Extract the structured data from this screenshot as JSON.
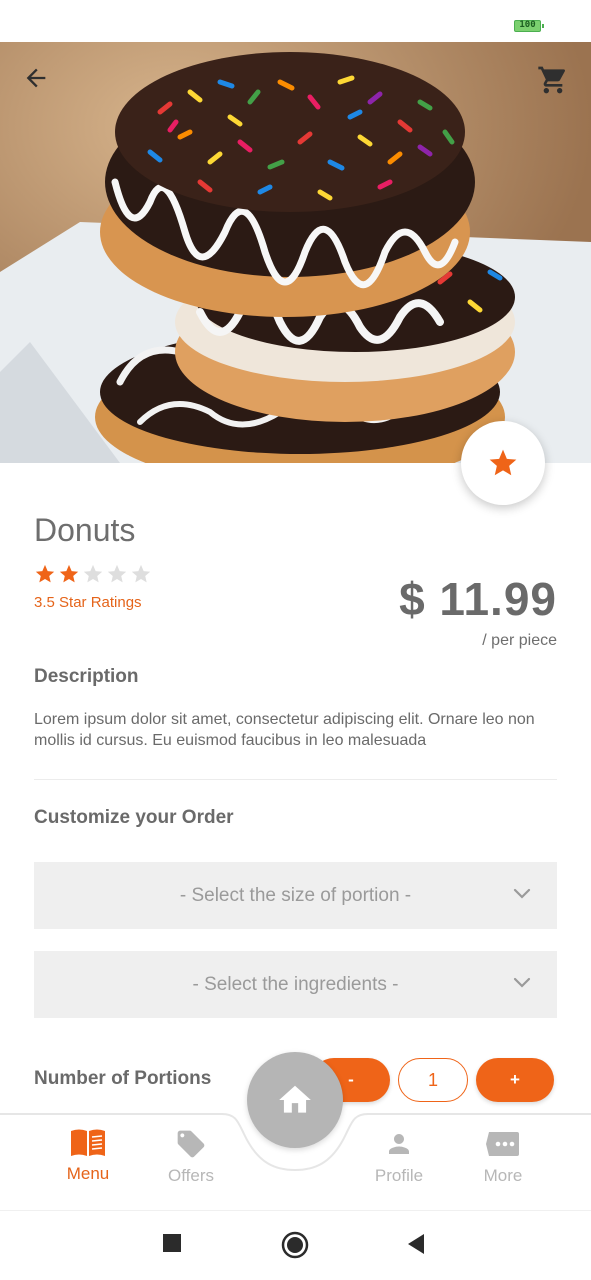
{
  "status_bar": {
    "battery": "100"
  },
  "product": {
    "name": "Donuts",
    "rating": 2,
    "rating_max": 5,
    "rating_text": "3.5 Star Ratings",
    "price": "$ 11.99",
    "price_unit": "/ per piece"
  },
  "description": {
    "title": "Description",
    "text": "Lorem ipsum dolor sit amet, consectetur adipiscing elit. Ornare leo non mollis id cursus. Eu euismod faucibus in leo malesuada"
  },
  "customize": {
    "title": "Customize your Order",
    "size_placeholder": "- Select the size of portion -",
    "ingredients_placeholder": "- Select the ingredients -"
  },
  "portions": {
    "title": "Number of Portions",
    "minus_label": "-",
    "value": "1",
    "plus_label": "+"
  },
  "nav": {
    "menu": "Menu",
    "offers": "Offers",
    "profile": "Profile",
    "more": "More"
  },
  "icons": {
    "back": "arrow-left-icon",
    "cart": "cart-icon",
    "favorite": "star-icon",
    "home": "home-icon",
    "menu": "book-icon",
    "offers": "tag-icon",
    "profile": "person-icon",
    "more": "more-icon"
  },
  "colors": {
    "accent": "#ef6418",
    "text": "#6a6a6a",
    "inactive": "#b7b7b7",
    "select_bg": "#efefef"
  }
}
